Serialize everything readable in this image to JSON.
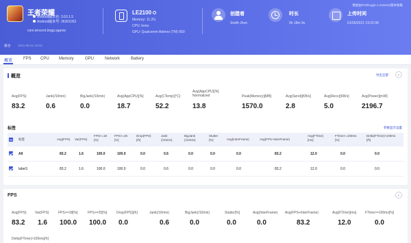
{
  "header": {
    "app_name": "王者荣耀",
    "android_version": "Android版本名: 3.63.1.5",
    "android_code": "Android版本号: 36301052",
    "package": "com.tencent.tmgp.sgame",
    "device_name": "LE2100",
    "memory": "Memory: 11.2G",
    "cpu": "CPU: kona",
    "gpu": "GPU: Qualcomm Adreno (TM) 650",
    "creator_label": "创建者",
    "creator_value": "Smith Jhon",
    "duration_label": "时长",
    "duration_value": "0h 18m 9s",
    "upload_label": "上传时间",
    "upload_value": "01/05/2021 19:22:08",
    "top_link": "数据由PerfDog(5.1.210204)版本收集",
    "remark_label": "备注:",
    "remark_value": "2021-05-01 19:22"
  },
  "tabs": [
    "概览",
    "FPS",
    "CPU",
    "Memory",
    "GPU",
    "Network",
    "Battery"
  ],
  "overview": {
    "title": "概览",
    "export": "导出全部",
    "collapse": "⌄",
    "metrics": [
      {
        "label": "Avg(FPS)",
        "value": "83.2"
      },
      {
        "label": "Jank(/10min)",
        "value": "0.6"
      },
      {
        "label": "BigJank(/10min)",
        "value": "0.0"
      },
      {
        "label": "Avg(AppCPU)[%]",
        "value": "18.7"
      },
      {
        "label": "Avg(CTemp)[°C]",
        "value": "52.2"
      },
      {
        "label": "Avg(AppCPU)[%]\nNormalized",
        "value": "13.8"
      },
      {
        "label": "Peak(Memory)[MB]",
        "value": "1570.0"
      },
      {
        "label": "Avg(Send)[KB/s]",
        "value": "2.8"
      },
      {
        "label": "Avg(Recv)[KB/s]",
        "value": "5.0"
      },
      {
        "label": "Avg(Power)[mW]",
        "value": "2196.7"
      }
    ]
  },
  "labels_table": {
    "title": "标签",
    "settings": "参数显示设置",
    "headers": [
      "标签",
      "Avg(FPS)",
      "Var(FPS)",
      "FPS>=18\n[%]",
      "FPS>=25\n[%]",
      "Drop(FPS)\n[/h]",
      "Jank\n(/10min)",
      "BigJank\n(/10min)",
      "Stutter\n[%]",
      "Avg(InterFrame)",
      "Avg(FPS+InterFrame)",
      "Avg(FTime)\n[ms]",
      "FTime>=100ms\n[%]",
      "Delta(FTime)>100ms\n[/h]"
    ],
    "rows": [
      [
        "All",
        "83.2",
        "1.6",
        "100.0",
        "100.0",
        "0.0",
        "0.6",
        "0.0",
        "0.0",
        "0.0",
        "83.2",
        "12.0",
        "0.0",
        "0.0"
      ],
      [
        "label1",
        "83.2",
        "1.6",
        "100.0",
        "100.0",
        "0.0",
        "0.6",
        "0.0",
        "0.0",
        "0.0",
        "83.2",
        "12.0",
        "0.0",
        "0.0"
      ]
    ]
  },
  "fps_section": {
    "title": "FPS",
    "collapse": "⌄",
    "metrics": [
      {
        "label": "Avg(FPS)",
        "value": "83.2"
      },
      {
        "label": "Var(FPS)",
        "value": "1.6"
      },
      {
        "label": "FPS>=18[%]",
        "value": "100.0"
      },
      {
        "label": "FPS>=25[%]",
        "value": "100.0"
      },
      {
        "label": "Drop(FPS)[/h]",
        "value": "0.0"
      },
      {
        "label": "Jank(/10min)",
        "value": "0.6"
      },
      {
        "label": "BigJank(/10min)",
        "value": "0.0"
      },
      {
        "label": "Stutter[%]",
        "value": "0.0"
      },
      {
        "label": "Avg(InterFrame)",
        "value": "0.0"
      },
      {
        "label": "Avg(FPS+InterFrame)",
        "value": "83.2"
      },
      {
        "label": "Avg(FTime)[ms]",
        "value": "12.0"
      },
      {
        "label": "FTime>=100ms[%]",
        "value": "0.0"
      }
    ],
    "extra_label": "Delta(FTime)>100ms[/h]"
  }
}
